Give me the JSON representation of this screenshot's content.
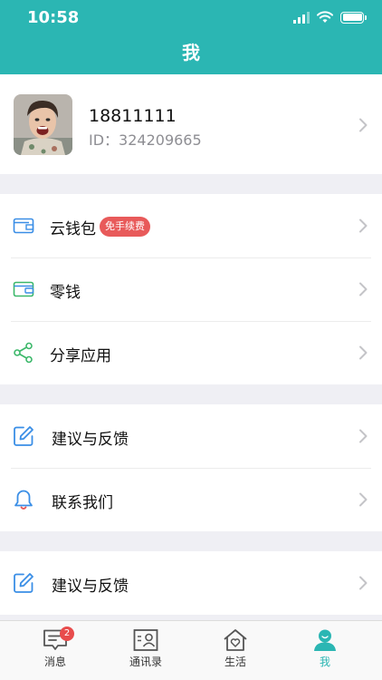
{
  "status_bar": {
    "time": "10:58"
  },
  "nav": {
    "title": "我"
  },
  "profile": {
    "phone": "18811111",
    "id_text": "ID：324209665"
  },
  "sections": [
    {
      "items": [
        {
          "label": "云钱包",
          "icon": "wallet-icon",
          "badge": "免手续费"
        },
        {
          "label": "零钱",
          "icon": "change-wallet-icon"
        },
        {
          "label": "分享应用",
          "icon": "share-icon"
        }
      ]
    },
    {
      "items": [
        {
          "label": "建议与反馈",
          "icon": "edit-icon"
        },
        {
          "label": "联系我们",
          "icon": "bell-icon"
        }
      ]
    },
    {
      "items": [
        {
          "label": "建议与反馈",
          "icon": "edit-icon"
        }
      ]
    }
  ],
  "tabbar": {
    "tabs": [
      {
        "label": "消息",
        "icon": "message-icon",
        "badge": "2"
      },
      {
        "label": "通讯录",
        "icon": "contacts-icon"
      },
      {
        "label": "生活",
        "icon": "home-heart-icon"
      },
      {
        "label": "我",
        "icon": "person-icon",
        "active": true
      }
    ]
  },
  "colors": {
    "accent": "#2bb6b3",
    "badge_red": "#e85a5a",
    "icon_blue": "#3a8ee6",
    "icon_green": "#3cb86a"
  }
}
